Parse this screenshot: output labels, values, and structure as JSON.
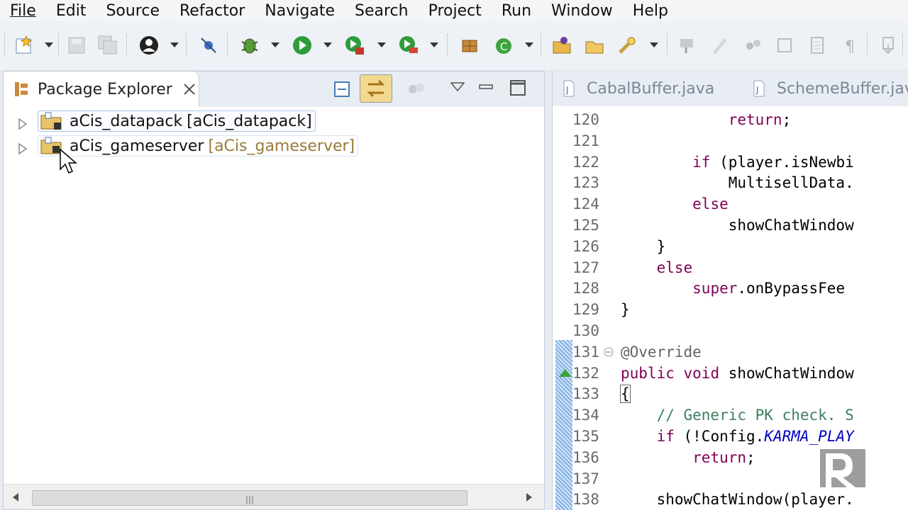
{
  "menu": [
    "File",
    "Edit",
    "Source",
    "Refactor",
    "Navigate",
    "Search",
    "Project",
    "Run",
    "Window",
    "Help"
  ],
  "view": {
    "title": "Package Explorer",
    "projects": [
      {
        "name": "aCis_datapack",
        "decoration": "[aCis_datapack]"
      },
      {
        "name": "aCis_gameserver",
        "decoration": "[aCis_gameserver]"
      }
    ]
  },
  "editor": {
    "tabs": [
      "CabalBuffer.java",
      "SchemeBuffer.java"
    ],
    "lines": [
      {
        "n": "120",
        "t": "            return;"
      },
      {
        "n": "121",
        "t": ""
      },
      {
        "n": "122",
        "t": "        if (player.isNewbi"
      },
      {
        "n": "123",
        "t": "            MultisellData."
      },
      {
        "n": "124",
        "t": "        else"
      },
      {
        "n": "125",
        "t": "            showChatWindow"
      },
      {
        "n": "126",
        "t": "    }"
      },
      {
        "n": "127",
        "t": "    else"
      },
      {
        "n": "128",
        "t": "        super.onBypassFee"
      },
      {
        "n": "129",
        "t": "}"
      },
      {
        "n": "130",
        "t": ""
      },
      {
        "n": "131",
        "t": "@Override"
      },
      {
        "n": "132",
        "t": "public void showChatWindow"
      },
      {
        "n": "133",
        "t": "{"
      },
      {
        "n": "134",
        "t": "    // Generic PK check. S"
      },
      {
        "n": "135",
        "t": "    if (!Config.KARMA_PLAY"
      },
      {
        "n": "136",
        "t": "        return;"
      },
      {
        "n": "137",
        "t": ""
      },
      {
        "n": "138",
        "t": "    showChatWindow(player."
      }
    ]
  },
  "colors": {
    "keyword": "#7f0055",
    "comment": "#3f7f5f",
    "annotation": "#646464",
    "static_field": "#0000c0"
  }
}
